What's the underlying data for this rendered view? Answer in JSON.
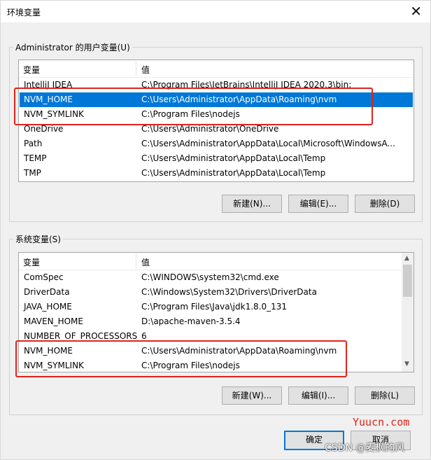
{
  "window": {
    "title": "环境变量",
    "close_icon": "close-icon"
  },
  "user_vars": {
    "group_label": "Administrator 的用户变量(U)",
    "headers": {
      "name": "变量",
      "value": "值"
    },
    "rows": [
      {
        "name": "IntelliJ IDEA",
        "value": "C:\\Program Files\\JetBrains\\IntelliJ IDEA 2020.3\\bin;"
      },
      {
        "name": "NVM_HOME",
        "value": "C:\\Users\\Administrator\\AppData\\Roaming\\nvm"
      },
      {
        "name": "NVM_SYMLINK",
        "value": "C:\\Program Files\\nodejs"
      },
      {
        "name": "OneDrive",
        "value": "C:\\Users\\Administrator\\OneDrive"
      },
      {
        "name": "Path",
        "value": "C:\\Users\\Administrator\\AppData\\Local\\Microsoft\\WindowsA..."
      },
      {
        "name": "TEMP",
        "value": "C:\\Users\\Administrator\\AppData\\Local\\Temp"
      },
      {
        "name": "TMP",
        "value": "C:\\Users\\Administrator\\AppData\\Local\\Temp"
      }
    ],
    "buttons": {
      "new": "新建(N)...",
      "edit": "编辑(E)...",
      "delete": "删除(D)"
    }
  },
  "system_vars": {
    "group_label": "系统变量(S)",
    "headers": {
      "name": "变量",
      "value": "值"
    },
    "rows": [
      {
        "name": "ComSpec",
        "value": "C:\\WINDOWS\\system32\\cmd.exe"
      },
      {
        "name": "DriverData",
        "value": "C:\\Windows\\System32\\Drivers\\DriverData"
      },
      {
        "name": "JAVA_HOME",
        "value": "C:\\Program Files\\Java\\jdk1.8.0_131"
      },
      {
        "name": "MAVEN_HOME",
        "value": "D:\\apache-maven-3.5.4"
      },
      {
        "name": "NUMBER_OF_PROCESSORS",
        "value": "6"
      },
      {
        "name": "NVM_HOME",
        "value": "C:\\Users\\Administrator\\AppData\\Roaming\\nvm"
      },
      {
        "name": "NVM_SYMLINK",
        "value": "C:\\Program Files\\nodejs"
      }
    ],
    "buttons": {
      "new": "新建(W)...",
      "edit": "编辑(I)...",
      "delete": "删除(L)"
    }
  },
  "footer": {
    "ok": "确定",
    "cancel": "取消"
  },
  "watermarks": {
    "site": "Yuucn.com",
    "csdn": "CSDN @麦枫的风"
  },
  "colors": {
    "selection": "#0078d7",
    "highlight_box": "#e0231a"
  }
}
